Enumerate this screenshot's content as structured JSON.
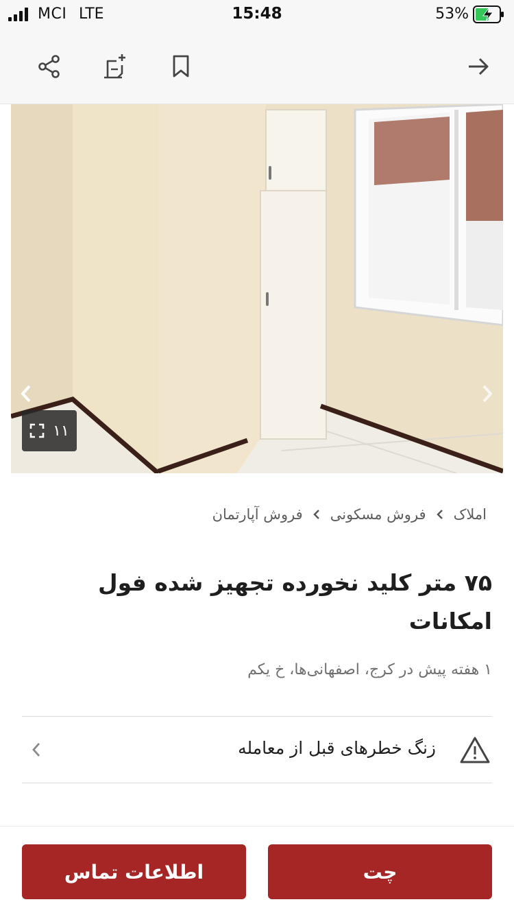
{
  "status_bar": {
    "carrier": "MCI",
    "network": "LTE",
    "time": "15:48",
    "battery": "53%",
    "battery_level": 0.53
  },
  "action_bar": {
    "icons": [
      "share-icon",
      "add-note-icon",
      "bookmark-icon",
      "arrow-right-icon"
    ]
  },
  "gallery": {
    "photo_count": "۱۱",
    "icons": [
      "chevron-left-icon",
      "chevron-right-icon",
      "expand-icon"
    ]
  },
  "breadcrumb": {
    "items": [
      "املاک",
      "فروش مسکونی",
      "فروش آپارتمان"
    ]
  },
  "listing": {
    "title": "۷۵ متر کلید نخورده تجهیز شده فول امکانات",
    "meta": "۱ هفته پیش در کرج، اصفهانی‌ها، خ یکم"
  },
  "warning": {
    "text": "زنگ خطرهای قبل از معامله",
    "icons": [
      "warning-icon",
      "chevron-left-icon"
    ]
  },
  "buttons": {
    "contact": "اطلاعات تماس",
    "chat": "چت"
  },
  "colors": {
    "accent": "#a62626",
    "battery_charging": "#34c759"
  }
}
